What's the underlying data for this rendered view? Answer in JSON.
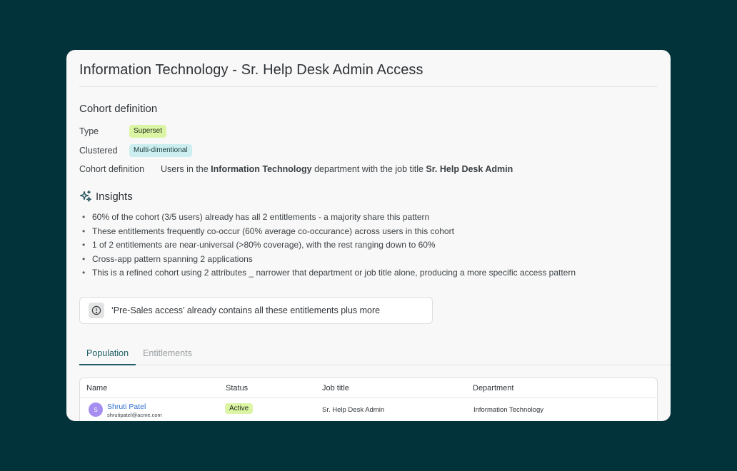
{
  "page": {
    "title": "Information Technology - Sr. Help Desk Admin Access"
  },
  "cohort": {
    "heading": "Cohort definition",
    "type_label": "Type",
    "type_value": "Superset",
    "clustered_label": "Clustered",
    "clustered_value": "Multi-dimentional",
    "definition_label": "Cohort definition",
    "definition_prefix": "Users in the ",
    "definition_department": "Information Technology",
    "definition_middle": " department with the job title ",
    "definition_title": "Sr. Help Desk Admin"
  },
  "insights": {
    "heading": "Insights",
    "items": [
      "60% of the cohort (3/5 users) already has all 2 entitlements - a majority share this pattern",
      "These entitlements frequently co-occur (60% average co-occurance) across users in this cohort",
      "1 of 2 entitlements are near-universal (>80% coverage), with the rest ranging down to 60%",
      "Cross-app pattern spanning 2 applications",
      "This is a refined cohort using 2 attributes _ narrower that department or job title alone, producing a more specific access pattern"
    ]
  },
  "notice": {
    "text": "‘Pre-Sales access’ already contains all these entitlements plus more"
  },
  "tabs": [
    {
      "label": "Population",
      "active": true
    },
    {
      "label": "Entitlements",
      "active": false
    }
  ],
  "table": {
    "columns": [
      "Name",
      "Status",
      "Job title",
      "Department"
    ],
    "rows": [
      {
        "avatar_initial": "S",
        "name": "Shruti Patel",
        "email": "shrutipatel@acme.com",
        "status": "Active",
        "job_title": "Sr. Help Desk Admin",
        "department": "Information Technology"
      }
    ]
  },
  "colors": {
    "background": "#02333a",
    "accent": "#1f5e66",
    "badge_green": "#dbf5a5",
    "badge_teal": "#cdeef0",
    "avatar": "#a68ef0",
    "link": "#2f6fd1"
  },
  "icons": {
    "insights": "sparkle-icon",
    "notice": "info-circle-icon"
  }
}
